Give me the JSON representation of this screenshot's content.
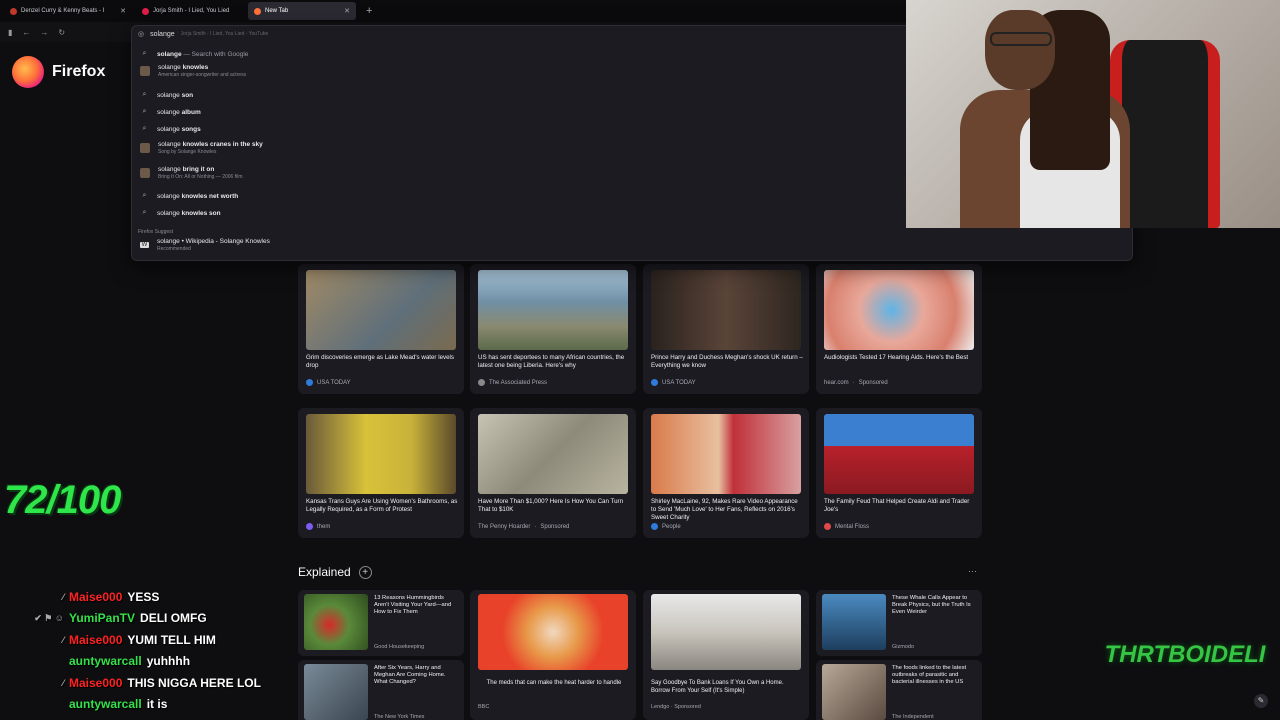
{
  "tabs": [
    {
      "label": "Denzel Curry & Kenny Beats - I",
      "color": "#c0392b",
      "active": false
    },
    {
      "label": "Jorja Smith - I Lied, You Lied",
      "color": "#e11d48",
      "active": false
    },
    {
      "label": "New Tab",
      "color": "#ff7139",
      "active": true
    }
  ],
  "new_tab_symbol": "+",
  "nav": {
    "back": "←",
    "forward": "→",
    "reload": "↻"
  },
  "urlbar": {
    "value": "solange",
    "ghost": "Jorja Smith - I Lied, You Lied - YouTube"
  },
  "suggestions": [
    {
      "icon": "search-icon",
      "bold": "solange",
      "rest": " — Search with Google",
      "sub": ""
    },
    {
      "icon": "thumb",
      "bold": "solange ",
      "rest": "knowles",
      "sub": "American singer-songwriter and actress"
    },
    {
      "icon": "search-icon",
      "bold": "solange ",
      "rest": "son",
      "sub": ""
    },
    {
      "icon": "search-icon",
      "bold": "solange ",
      "rest": "album",
      "sub": ""
    },
    {
      "icon": "search-icon",
      "bold": "solange ",
      "rest": "songs",
      "sub": ""
    },
    {
      "icon": "thumb",
      "bold": "solange ",
      "rest": "knowles cranes in the sky",
      "sub": "Song by Solange Knowles"
    },
    {
      "icon": "thumb",
      "bold": "solange ",
      "rest": "bring it on",
      "sub": "Bring It On: All or Nothing — 2006 film"
    },
    {
      "icon": "search-icon",
      "bold": "solange ",
      "rest": "knowles net worth",
      "sub": ""
    },
    {
      "icon": "search-icon",
      "bold": "solange ",
      "rest": "knowles son",
      "sub": ""
    }
  ],
  "firefox_suggest": {
    "heading": "Firefox Suggest",
    "bold": "solange",
    "rest": " • Wikipedia - Solange Knowles",
    "sub": "Recommended"
  },
  "brand": {
    "name": "Firefox"
  },
  "score": "72/100",
  "chat": [
    {
      "user": "Maise000",
      "user_color": "#ff2222",
      "msg": "YESS",
      "badges": "⁄"
    },
    {
      "user": "YumiPanTV",
      "user_color": "#35e04a",
      "msg": "DELI OMFG",
      "badges": "✔ ⚑ ☺"
    },
    {
      "user": "Maise000",
      "user_color": "#ff2222",
      "msg": "YUMI TELL HIM",
      "badges": "⁄"
    },
    {
      "user": "auntywarcall",
      "user_color": "#35e04a",
      "msg": "yuhhhh",
      "badges": ""
    },
    {
      "user": "Maise000",
      "user_color": "#ff2222",
      "msg": "THIS NIGGA HERE LOL",
      "badges": "⁄"
    },
    {
      "user": "auntywarcall",
      "user_color": "#35e04a",
      "msg": "it is",
      "badges": ""
    }
  ],
  "stories_row1": [
    {
      "title": "Grim discoveries emerge as Lake Mead's water levels drop",
      "source": "USA TODAY",
      "sponsored": "",
      "img": "#8a7a5e",
      "fav": "#2f7bd9"
    },
    {
      "title": "US has sent deportees to many African countries, the latest one being Liberia. Here's why",
      "source": "The Associated Press",
      "sponsored": "",
      "img": "#6f8fa4",
      "fav": "#888"
    },
    {
      "title": "Prince Harry and Duchess Meghan's shock UK return – Everything we know",
      "source": "USA TODAY",
      "sponsored": "",
      "img": "#3a2f2b",
      "fav": "#2f7bd9"
    },
    {
      "title": "Audiologists Tested 17 Hearing Aids. Here's the Best",
      "source": "hear.com",
      "sponsored": "Sponsored",
      "img": "#d99b86",
      "fav": ""
    }
  ],
  "stories_row2": [
    {
      "title": "Kansas Trans Guys Are Using Women's Bathrooms, as Legally Required, as a Form of Protest",
      "source": "them",
      "sponsored": "",
      "img": "#c9b23a",
      "fav": "#7d5cf0"
    },
    {
      "title": "Have More Than $1,000? Here Is How You Can Turn That to $10K",
      "source": "The Penny Hoarder",
      "sponsored": "Sponsored",
      "img": "#9e9a8e",
      "fav": ""
    },
    {
      "title": "Shirley MacLaine, 92, Makes Rare Video Appearance to Send 'Much Love' to Her Fans, Reflects on 2016's Sweet Charity",
      "source": "People",
      "sponsored": "",
      "img": "#c0503a",
      "fav": "#2f7bd9"
    },
    {
      "title": "The Family Feud That Helped Create Aldi and Trader Joe's",
      "source": "Mental Floss",
      "sponsored": "",
      "img": "#b8212b",
      "fav": "#e0484a"
    }
  ],
  "explained": {
    "heading": "Explained",
    "add": "+",
    "more": "···"
  },
  "explained_cards": [
    {
      "title": "13 Reasons Hummingbirds Aren't Visiting Your Yard—and How to Fix Them",
      "source": "Good Housekeeping",
      "img": "#5a8a3a"
    },
    {
      "title": "The meds that can make the heat harder to handle",
      "source": "BBC",
      "img": "#e8432a",
      "big": true
    },
    {
      "title": "Say Goodbye To Bank Loans If You Own a Home. Borrow From Your Self (It's Simple)",
      "source": "Lendgo · Sponsored",
      "img": "#a6a29a",
      "big": true
    },
    {
      "title": "These Whale Calls Appear to Break Physics, but the Truth Is Even Weirder",
      "source": "Gizmodo",
      "img": "#2e5f86"
    },
    {
      "title": "After Six Years, Harry and Meghan Are Coming Home. What Changed?",
      "source": "The New York Times",
      "img": "#5c6b78"
    },
    {
      "title": "The foods linked to the latest outbreaks of parasitic and bacterial illnesses in the US",
      "source": "The Independent",
      "img": "#8a7464"
    }
  ],
  "watermark": "THRTBOIDELI"
}
